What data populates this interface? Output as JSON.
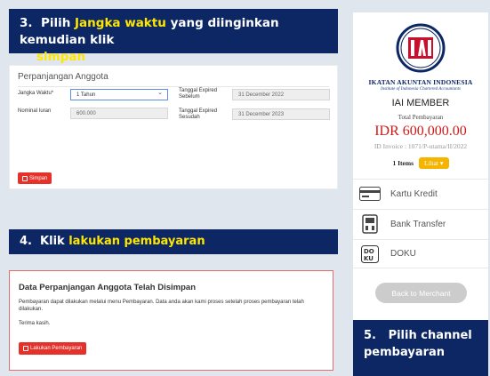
{
  "banner3": {
    "number": "3.",
    "pre": "Pilih",
    "highlight": "Jangka waktu",
    "mid": "yang diinginkan kemudian klik",
    "highlight2": "simpan"
  },
  "form": {
    "title": "Perpanjangan Anggota",
    "jangka_label": "Jangka Waktu*",
    "jangka_value": "1 Tahun",
    "nominal_label": "Nominal Iuran",
    "nominal_value": "600.000",
    "expired_before_label": "Tanggal Expired Sebelum",
    "expired_before_value": "31 December 2022",
    "expired_after_label": "Tanggal Expired Sesudah",
    "expired_after_value": "31 December 2023",
    "save_label": "Simpan"
  },
  "banner4": {
    "number": "4.",
    "pre": "Klik",
    "highlight": "lakukan pembayaran"
  },
  "saved": {
    "title": "Data Perpanjangan Anggota Telah Disimpan",
    "text1": "Pembayaran dapat dilakukan melalui menu Pembayaran. Data anda akan kami proses setelah proses pembayaran telah dilakukan.",
    "text2": "Terima kasih.",
    "pay_button": "Lakukan Pembayaran"
  },
  "payment": {
    "org_name": "IKATAN AKUNTAN INDONESIA",
    "org_sub": "Institute of Indonesia Chartered Accountants",
    "member": "IAI MEMBER",
    "total_label": "Total Pembayaran",
    "amount": "IDR 600,000.00",
    "invoice": "ID Invoice : 1071/P-utama/II/2022",
    "items": "1 Items",
    "lihat": "Lihat",
    "options": [
      {
        "label": "Kartu Kredit",
        "icon": "credit-card-icon"
      },
      {
        "label": "Bank Transfer",
        "icon": "bank-transfer-icon"
      },
      {
        "label": "DOKU",
        "icon": "doku-icon"
      }
    ],
    "back": "Back to Merchant"
  },
  "banner5": {
    "number": "5.",
    "text": "Pilih channel pembayaran"
  },
  "colors": {
    "navy": "#0c2763",
    "highlight": "#ffe600",
    "red": "#e4322b",
    "amount": "#cc1a1a",
    "lihat": "#f5b400"
  }
}
